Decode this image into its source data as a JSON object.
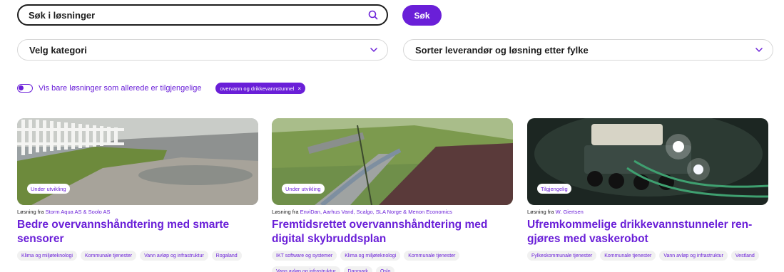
{
  "search": {
    "placeholder": "Søk i løsninger",
    "button_label": "Søk"
  },
  "filters": {
    "category_label": "Velg kategori",
    "county_label": "Sorter leverandør og løsning etter fylke",
    "available_only_label": "Vis bare løsninger som allerede er tilgjengelige",
    "active_chip": "overvann og drikkevannstunnel",
    "chip_remove": "×"
  },
  "cards": [
    {
      "status": "Under utvikling",
      "by_prefix": "Løsning fra ",
      "vendor": "Storm Aqua AS & Soolo AS",
      "title": "Bedre overvannshåndtering med smarte sensorer",
      "tags": [
        "Klima og miljøteknologi",
        "Kommunale tjenester",
        "Vann avløp og infrastruktur",
        "Rogaland"
      ]
    },
    {
      "status": "Under utvikling",
      "by_prefix": "Løsning fra ",
      "vendor": "EnviDan, Aarhus Vand, Scalgo, SLA Norge & Menon Economics",
      "title": "Fremtidsrettet overvannshåndtering med digital skybruddsplan",
      "tags": [
        "IKT software og systemer",
        "Klima og miljøteknologi",
        "Kommunale tjenester",
        "Vann avløp og infrastruktur",
        "Danmark",
        "Oslo"
      ]
    },
    {
      "status": "Tilgjengelig",
      "by_prefix": "Løsning fra ",
      "vendor": "W. Giertsen",
      "title": "Ufremkommelige drikkevannstunneler ren-gjøres med vaskerobot",
      "tags": [
        "Fylkeskommunale tjenester",
        "Kommunale tjenester",
        "Vann avløp og infrastruktur",
        "Vestland"
      ]
    }
  ],
  "colors": {
    "accent": "#6a1fd8",
    "text": "#1d1d1d",
    "tag_bg": "#f1f1f1"
  }
}
